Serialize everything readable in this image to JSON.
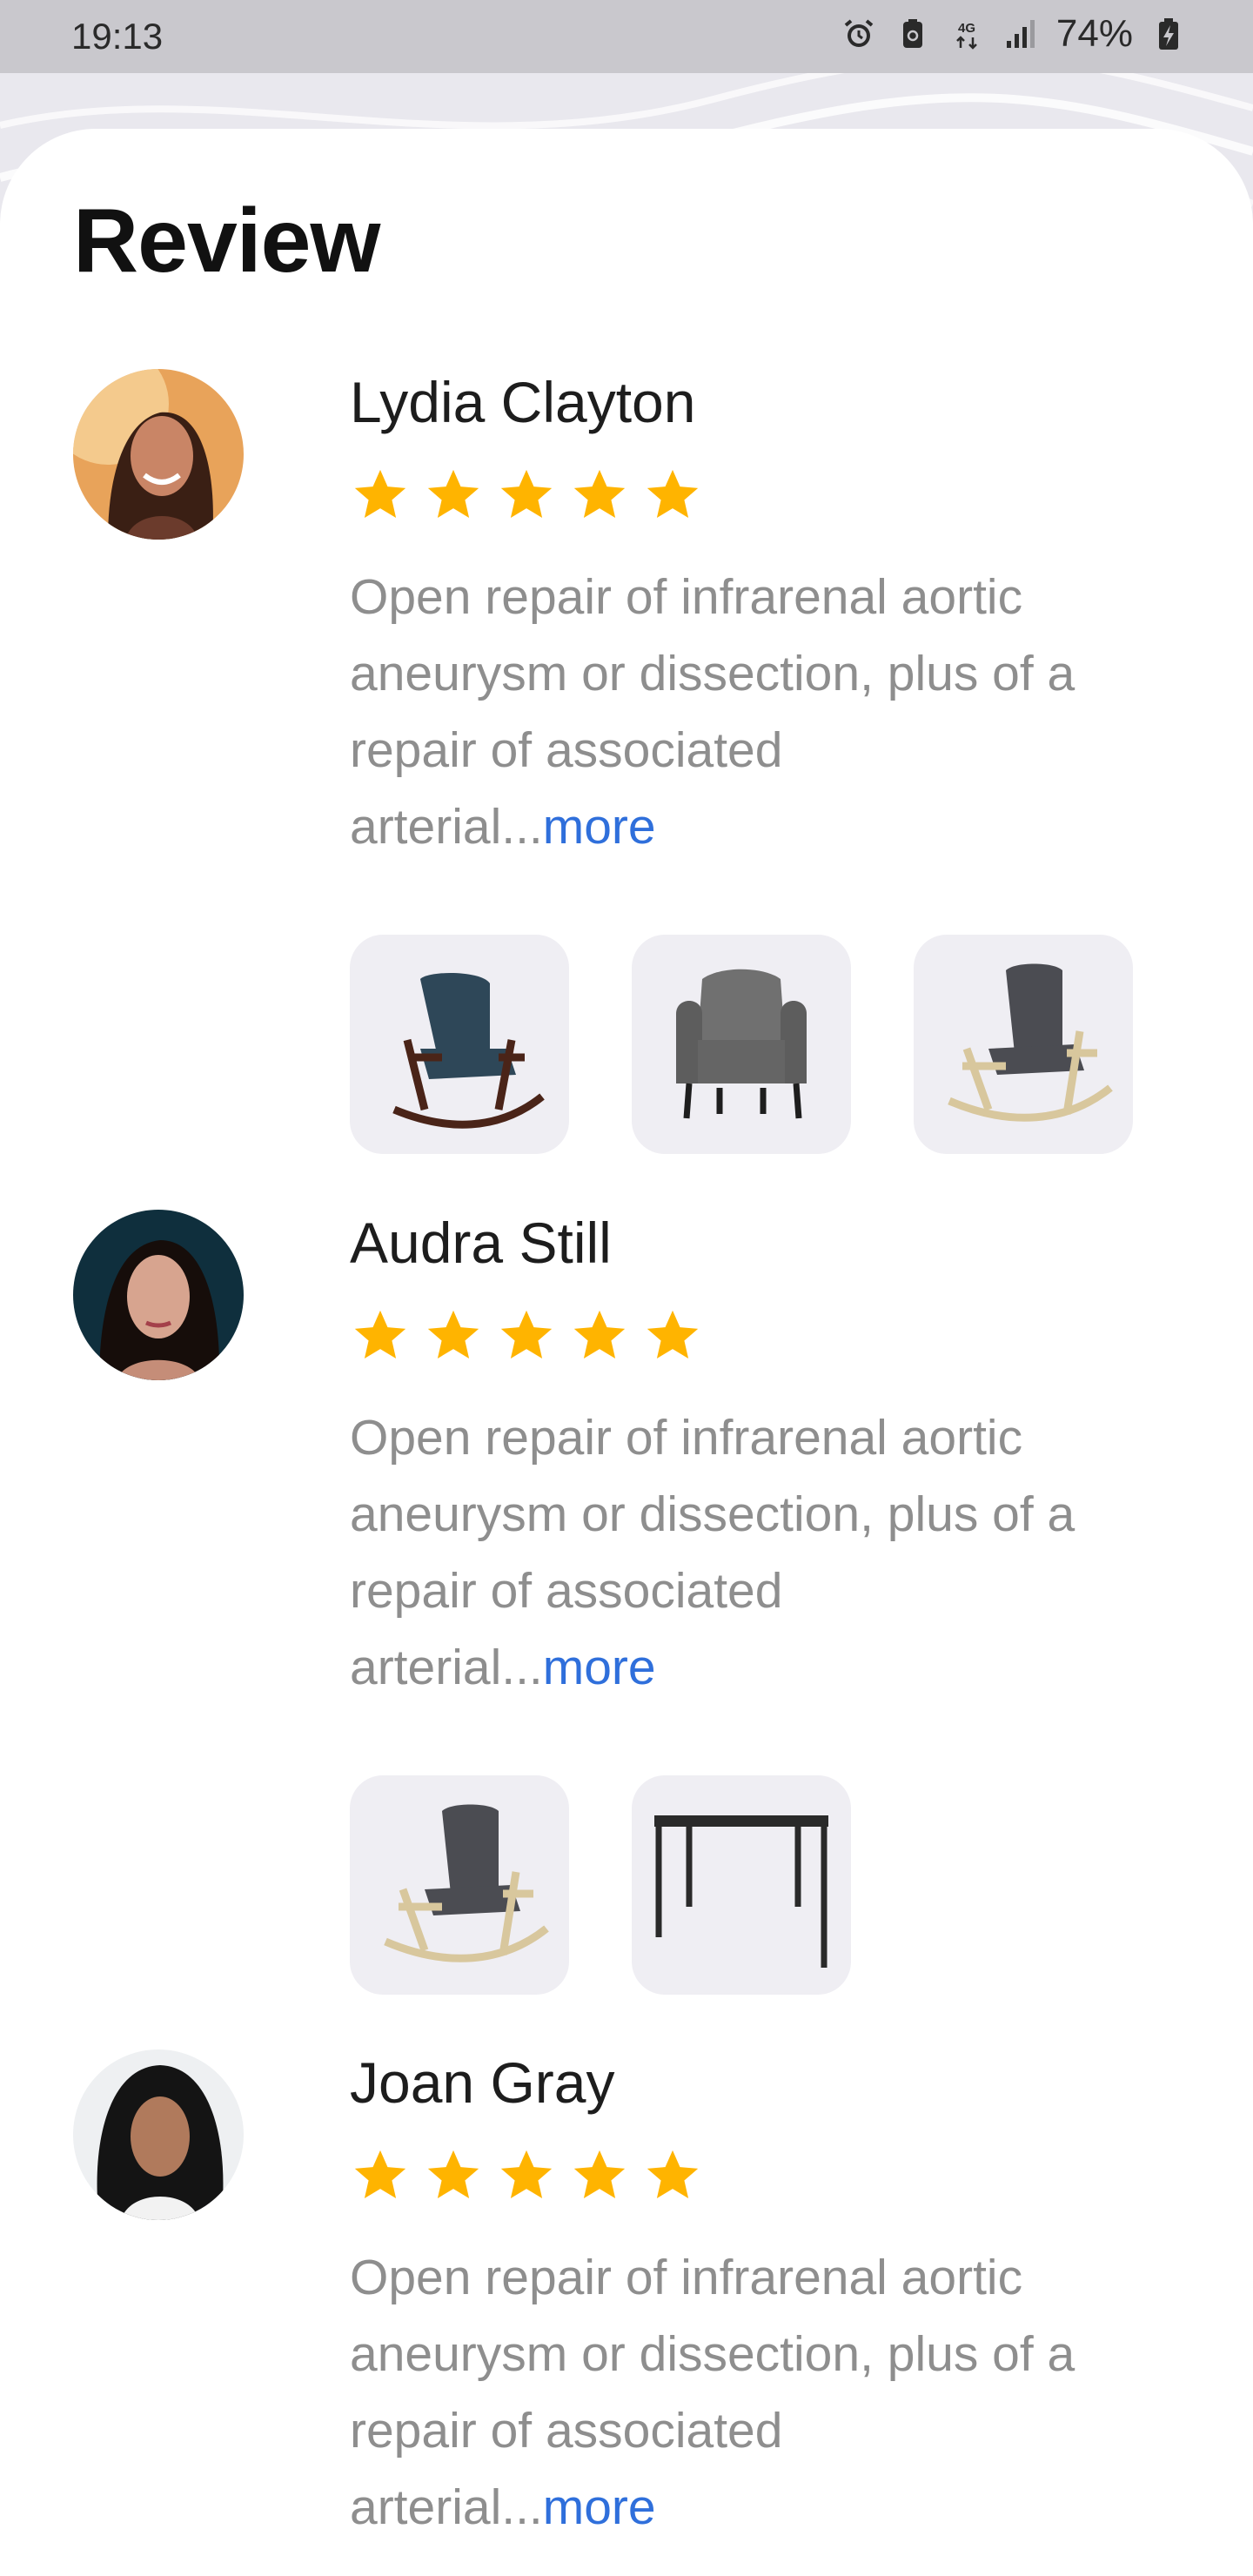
{
  "status_bar": {
    "time": "19:13",
    "network": "4G",
    "battery": "74%",
    "icons": [
      "alarm-icon",
      "battery-saver-icon",
      "network-4g-icon",
      "signal-icon",
      "battery-charging-icon"
    ]
  },
  "page": {
    "title": "Review"
  },
  "colors": {
    "star": "#ffb400",
    "link": "#2f6fdb",
    "text_muted": "#8e8e8e"
  },
  "reviews": [
    {
      "name": "Lydia Clayton",
      "rating": 5,
      "text_line1": "Open repair of infrarenal aortic",
      "text_line2": "aneurysm or dissection, plus of a",
      "text_line3": "repair of associated",
      "text_line4": "arterial...",
      "more_label": "more",
      "thumbnails": [
        "rocking-chair-dark",
        "wingback-armchair",
        "rocking-chair-light"
      ]
    },
    {
      "name": "Audra Still",
      "rating": 5,
      "text_line1": "Open repair of infrarenal aortic",
      "text_line2": "aneurysm or dissection, plus of a",
      "text_line3": "repair of associated",
      "text_line4": "arterial...",
      "more_label": "more",
      "thumbnails": [
        "rocking-chair-light",
        "dining-table"
      ]
    },
    {
      "name": "Joan Gray",
      "rating": 5,
      "text_line1": "Open repair of infrarenal aortic",
      "text_line2": "aneurysm or dissection, plus of a",
      "text_line3": "repair of associated",
      "text_line4": "arterial...",
      "more_label": "more",
      "thumbnails": []
    }
  ]
}
